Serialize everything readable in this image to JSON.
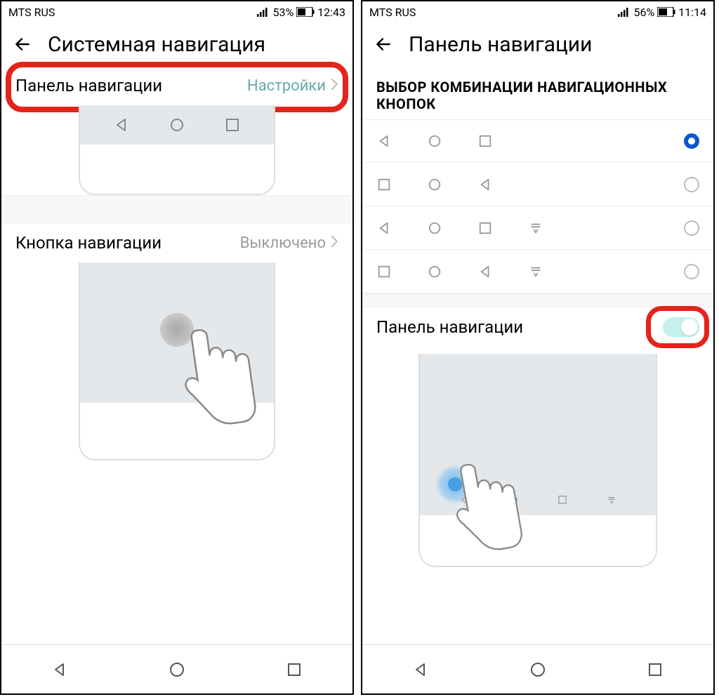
{
  "left": {
    "status": {
      "carrier": "MTS RUS",
      "battery": "53%",
      "time": "12:43"
    },
    "title": "Системная навигация",
    "row1": {
      "label": "Панель навигации",
      "value": "Настройки"
    },
    "row2": {
      "label": "Кнопка навигации",
      "value": "Выключено"
    }
  },
  "right": {
    "status": {
      "carrier": "MTS RUS",
      "battery": "56%",
      "time": "11:14"
    },
    "title": "Панель навигации",
    "sectionHeader": "ВЫБОР КОМБИНАЦИИ НАВИГАЦИОННЫХ КНОПОК",
    "combos": [
      {
        "order": [
          "back",
          "home",
          "recent"
        ],
        "selected": true
      },
      {
        "order": [
          "recent",
          "home",
          "back"
        ],
        "selected": false
      },
      {
        "order": [
          "back",
          "home",
          "recent",
          "notif"
        ],
        "selected": false
      },
      {
        "order": [
          "recent",
          "home",
          "back",
          "notif"
        ],
        "selected": false
      }
    ],
    "toggleLabel": "Панель навигации",
    "toggleOn": true
  }
}
